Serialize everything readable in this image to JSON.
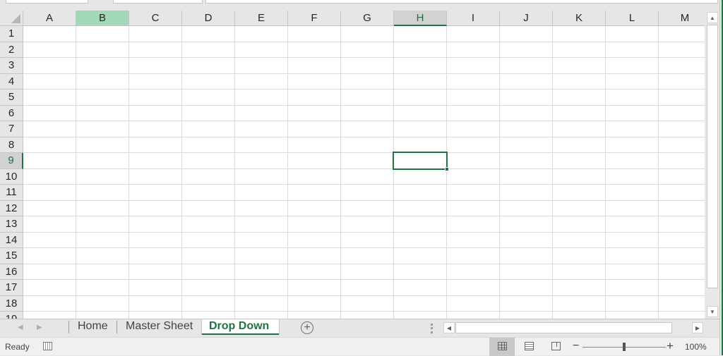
{
  "spreadsheet": {
    "columns": [
      "A",
      "B",
      "C",
      "D",
      "E",
      "F",
      "G",
      "H",
      "I",
      "J",
      "K",
      "L",
      "M"
    ],
    "rows": [
      "1",
      "2",
      "3",
      "4",
      "5",
      "6",
      "7",
      "8",
      "9",
      "10",
      "11",
      "12",
      "13",
      "14",
      "15",
      "16",
      "17",
      "18",
      "19"
    ],
    "highlighted_column": "B",
    "active_cell": {
      "column": "H",
      "row": "9",
      "value": ""
    }
  },
  "sheet_tabs": {
    "tabs": [
      {
        "label": "Home",
        "active": false
      },
      {
        "label": "Master Sheet",
        "active": false
      },
      {
        "label": "Drop Down",
        "active": true
      }
    ],
    "add_sheet_icon": "plus-circle-icon",
    "prev_icon": "chevron-left-icon",
    "next_icon": "chevron-right-icon"
  },
  "status_bar": {
    "status": "Ready",
    "macro_icon": "macro-recording-icon",
    "view_modes": [
      "normal-view-icon",
      "page-layout-icon",
      "page-break-preview-icon"
    ],
    "zoom_minus": "−",
    "zoom_plus": "+",
    "zoom_level": "100%",
    "zoom_percent": 100
  },
  "glyphs": {
    "up": "▲",
    "down": "▼",
    "left": "◀",
    "right": "▶",
    "plus": "+"
  }
}
